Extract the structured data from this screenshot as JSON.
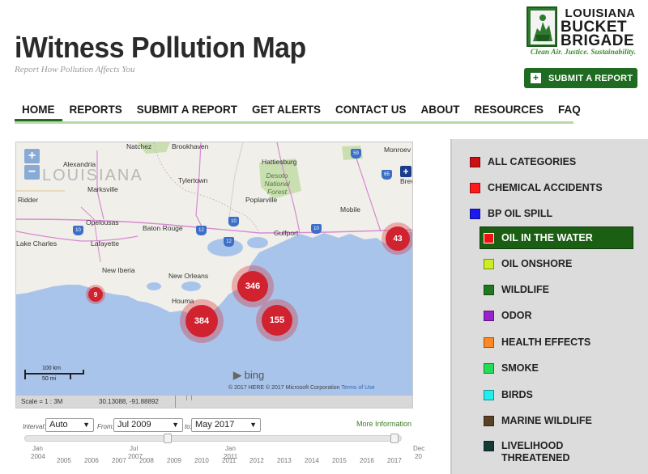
{
  "site": {
    "title": "iWitness Pollution Map",
    "tagline": "Report How Pollution Affects You"
  },
  "logo": {
    "line1": "LOUISIANA",
    "line2": "BUCKET",
    "line3": "BRIGADE",
    "slogan": "Clean Air. Justice. Sustainability."
  },
  "header_button": {
    "label": "SUBMIT A REPORT",
    "icon": "plus-icon"
  },
  "nav": {
    "items": [
      {
        "label": "HOME",
        "active": true
      },
      {
        "label": "REPORTS"
      },
      {
        "label": "SUBMIT A REPORT"
      },
      {
        "label": "GET ALERTS"
      },
      {
        "label": "CONTACT US"
      },
      {
        "label": "ABOUT"
      },
      {
        "label": "RESOURCES"
      },
      {
        "label": "FAQ"
      }
    ]
  },
  "map": {
    "zoom_in": "+",
    "zoom_out": "−",
    "watermark_state": "LOUISIANA",
    "places": [
      "Natchez",
      "Brookhaven",
      "Monroev",
      "Alexandria",
      "Hattiesburg",
      "Marksville",
      "Tylertown",
      "Desoto National Forest",
      "Poplarville",
      "Brev",
      "Ridder",
      "Opelousas",
      "Baton Rouge",
      "Mobile",
      "Lake Charles",
      "Lafayette",
      "Gulfport",
      "New Iberia",
      "New Orleans",
      "Houma"
    ],
    "highways": [
      "59",
      "65",
      "12",
      "12",
      "10",
      "10",
      "10"
    ],
    "clusters": [
      {
        "count": "43"
      },
      {
        "count": "346"
      },
      {
        "count": "9"
      },
      {
        "count": "384"
      },
      {
        "count": "155"
      }
    ],
    "scale_km": "100 km",
    "scale_mi": "50 mi",
    "bing": "bing",
    "copyright": "© 2017 HERE © 2017 Microsoft Corporation",
    "terms": "Terms of Use",
    "scale_text": "Scale = 1 : 3M",
    "coords": "30.13088, -91.88892"
  },
  "controls": {
    "interval_label": "Interval:",
    "interval_value": "Auto",
    "from_label": "From:",
    "from_value": "Jul 2009",
    "to_label": "to:",
    "to_value": "May 2017",
    "more_info": "More Information",
    "slider_start": 0.38,
    "slider_end": 0.98
  },
  "timeline": {
    "major": [
      {
        "month": "Jan",
        "year": "2004"
      },
      {
        "month": "Jul",
        "year": "2007"
      },
      {
        "month": "Jan",
        "year": "2011"
      },
      {
        "month": "Dec",
        "year": "20"
      }
    ],
    "years": [
      "2005",
      "2006",
      "2007",
      "2008",
      "2009",
      "2010",
      "2011",
      "2012",
      "2013",
      "2014",
      "2015",
      "2016",
      "2017"
    ]
  },
  "categories": [
    {
      "label": "ALL CATEGORIES",
      "color": "#cc1111"
    },
    {
      "label": "CHEMICAL ACCIDENTS",
      "color": "#ff1a1a"
    },
    {
      "label": "BP OIL SPILL",
      "color": "#1a1aee"
    },
    {
      "label": "OIL IN THE WATER",
      "color": "#ee1111",
      "active": true
    },
    {
      "label": "OIL ONSHORE",
      "color": "#ccee22"
    },
    {
      "label": "WILDLIFE",
      "color": "#1f7a1f"
    },
    {
      "label": "ODOR",
      "color": "#9922cc"
    },
    {
      "label": "HEALTH EFFECTS",
      "color": "#ff8822"
    },
    {
      "label": "SMOKE",
      "color": "#22dd55"
    },
    {
      "label": "BIRDS",
      "color": "#22eeee"
    },
    {
      "label": "MARINE WILDLIFE",
      "color": "#5a4024"
    },
    {
      "label": "LIVELIHOOD THREATENED",
      "color": "#143c34"
    }
  ]
}
